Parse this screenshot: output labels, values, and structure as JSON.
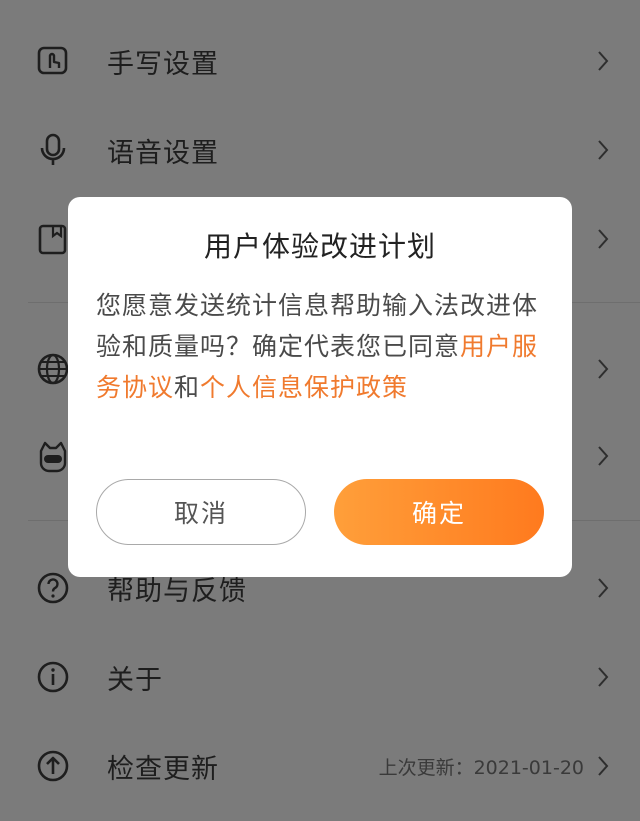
{
  "settings": {
    "items": [
      {
        "label": "手写设置",
        "icon": "handwriting-icon"
      },
      {
        "label": "语音设置",
        "icon": "microphone-icon"
      },
      {
        "label": "",
        "icon": "book-icon"
      },
      {
        "label": "",
        "icon": "globe-icon"
      },
      {
        "label": "",
        "icon": "mascot-icon"
      },
      {
        "label": "帮助与反馈",
        "icon": "help-icon"
      },
      {
        "label": "关于",
        "icon": "info-icon"
      },
      {
        "label": "检查更新",
        "icon": "upload-icon"
      }
    ],
    "update_meta": "上次更新：2021-01-20"
  },
  "dialog": {
    "title": "用户体验改进计划",
    "body_prefix": "您愿意发送统计信息帮助输入法改进体验和质量吗？确定代表您已同意",
    "link_service": "用户服务协议",
    "conjunction": "和",
    "link_privacy": "个人信息保护政策",
    "cancel_label": "取消",
    "confirm_label": "确定"
  },
  "colors": {
    "overlay": "#7b7b7b",
    "accent": "#f07a2e",
    "confirm_gradient_start": "#ff9f3a",
    "confirm_gradient_end": "#ff7a1e"
  }
}
